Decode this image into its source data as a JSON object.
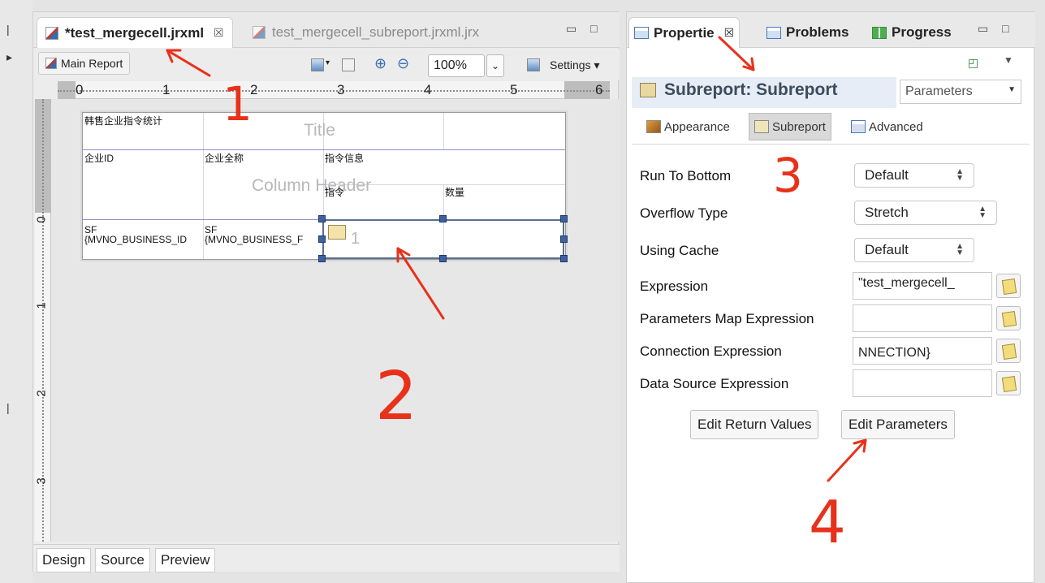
{
  "editor": {
    "tabs": [
      {
        "label": "*test_mergecell.jrxml",
        "close": "☒"
      },
      {
        "label": "test_mergecell_subreport.jrxml.jrx"
      }
    ],
    "toolbar": {
      "main_report": "Main Report",
      "zoom": "100%",
      "settings": "Settings ▾"
    },
    "ruler": {
      "h": [
        "0",
        "1",
        "2",
        "3",
        "4",
        "5",
        "6"
      ],
      "v": [
        "0",
        "1",
        "2",
        "3"
      ]
    },
    "report": {
      "bands": {
        "title": "Title",
        "column_header": "Column Header"
      },
      "cells": {
        "title_text": "韩售企业指令统计",
        "enterprise_id": "企业ID",
        "enterprise_name": "企业全称",
        "cmd_info": "指令信息",
        "cmd": "指令",
        "count": "数量",
        "sf1_a": "SF",
        "sf1_b": "{MVNO_BUSINESS_ID",
        "sf2_a": "SF",
        "sf2_b": "{MVNO_BUSINESS_F",
        "sub_num": "1"
      }
    },
    "bottom_tabs": [
      "Design",
      "Source",
      "Preview"
    ]
  },
  "properties": {
    "tabs": [
      {
        "label": "Propertie",
        "close": "☒"
      },
      {
        "label": "Problems"
      },
      {
        "label": "Progress"
      }
    ],
    "title": "Subreport: Subreport",
    "section_select": "Parameters",
    "subtabs": [
      "Appearance",
      "Subreport",
      "Advanced"
    ],
    "rows": [
      {
        "label": "Run To Bottom",
        "value": "Default"
      },
      {
        "label": "Overflow Type",
        "value": "Stretch"
      },
      {
        "label": "Using Cache",
        "value": "Default"
      },
      {
        "label": "Expression",
        "value": "\"test_mergecell_"
      },
      {
        "label": "Parameters Map Expression",
        "value": ""
      },
      {
        "label": "Connection Expression",
        "value": "NNECTION}"
      },
      {
        "label": "Data Source Expression",
        "value": ""
      }
    ],
    "buttons": {
      "edit_return": "Edit Return Values",
      "edit_params": "Edit Parameters"
    }
  },
  "annotations": [
    "1",
    "2",
    "3",
    "4"
  ],
  "colors": {
    "annotation": "#e8311a",
    "selection_handle": "#3e62a0",
    "header_strip": "#e6edf6"
  }
}
